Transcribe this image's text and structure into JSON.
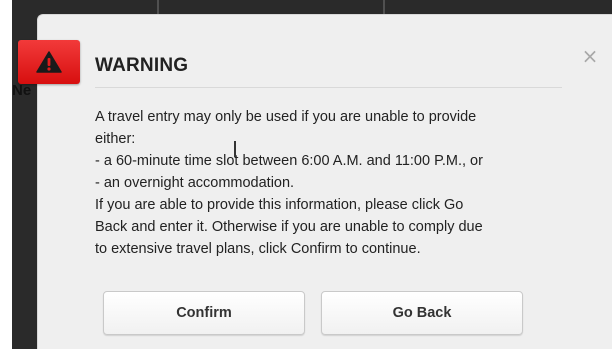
{
  "background": {
    "partial_text": "Ne"
  },
  "dialog": {
    "title": "WARNING",
    "close_symbol": "×",
    "icon": "warning-triangle-icon",
    "accent_color": "#e21d1d",
    "message_lines": [
      "A travel entry may only be used if you are unable to provide",
      "either:",
      "- a 60-minute time slot between 6:00 A.M. and 11:00 P.M., or",
      "- an overnight accommodation.",
      "If you are able to provide this information, please click Go",
      "Back and enter it. Otherwise if you are unable to comply due",
      "to extensive travel plans, click Confirm to continue."
    ],
    "buttons": {
      "confirm_label": "Confirm",
      "go_back_label": "Go Back"
    }
  }
}
